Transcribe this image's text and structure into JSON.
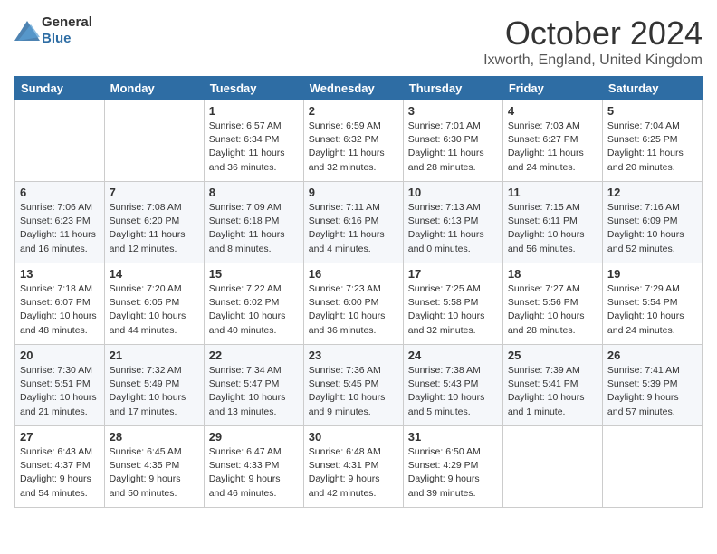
{
  "header": {
    "logo_general": "General",
    "logo_blue": "Blue",
    "month": "October 2024",
    "location": "Ixworth, England, United Kingdom"
  },
  "days_of_week": [
    "Sunday",
    "Monday",
    "Tuesday",
    "Wednesday",
    "Thursday",
    "Friday",
    "Saturday"
  ],
  "weeks": [
    [
      {
        "day": "",
        "info": ""
      },
      {
        "day": "",
        "info": ""
      },
      {
        "day": "1",
        "info": "Sunrise: 6:57 AM\nSunset: 6:34 PM\nDaylight: 11 hours\nand 36 minutes."
      },
      {
        "day": "2",
        "info": "Sunrise: 6:59 AM\nSunset: 6:32 PM\nDaylight: 11 hours\nand 32 minutes."
      },
      {
        "day": "3",
        "info": "Sunrise: 7:01 AM\nSunset: 6:30 PM\nDaylight: 11 hours\nand 28 minutes."
      },
      {
        "day": "4",
        "info": "Sunrise: 7:03 AM\nSunset: 6:27 PM\nDaylight: 11 hours\nand 24 minutes."
      },
      {
        "day": "5",
        "info": "Sunrise: 7:04 AM\nSunset: 6:25 PM\nDaylight: 11 hours\nand 20 minutes."
      }
    ],
    [
      {
        "day": "6",
        "info": "Sunrise: 7:06 AM\nSunset: 6:23 PM\nDaylight: 11 hours\nand 16 minutes."
      },
      {
        "day": "7",
        "info": "Sunrise: 7:08 AM\nSunset: 6:20 PM\nDaylight: 11 hours\nand 12 minutes."
      },
      {
        "day": "8",
        "info": "Sunrise: 7:09 AM\nSunset: 6:18 PM\nDaylight: 11 hours\nand 8 minutes."
      },
      {
        "day": "9",
        "info": "Sunrise: 7:11 AM\nSunset: 6:16 PM\nDaylight: 11 hours\nand 4 minutes."
      },
      {
        "day": "10",
        "info": "Sunrise: 7:13 AM\nSunset: 6:13 PM\nDaylight: 11 hours\nand 0 minutes."
      },
      {
        "day": "11",
        "info": "Sunrise: 7:15 AM\nSunset: 6:11 PM\nDaylight: 10 hours\nand 56 minutes."
      },
      {
        "day": "12",
        "info": "Sunrise: 7:16 AM\nSunset: 6:09 PM\nDaylight: 10 hours\nand 52 minutes."
      }
    ],
    [
      {
        "day": "13",
        "info": "Sunrise: 7:18 AM\nSunset: 6:07 PM\nDaylight: 10 hours\nand 48 minutes."
      },
      {
        "day": "14",
        "info": "Sunrise: 7:20 AM\nSunset: 6:05 PM\nDaylight: 10 hours\nand 44 minutes."
      },
      {
        "day": "15",
        "info": "Sunrise: 7:22 AM\nSunset: 6:02 PM\nDaylight: 10 hours\nand 40 minutes."
      },
      {
        "day": "16",
        "info": "Sunrise: 7:23 AM\nSunset: 6:00 PM\nDaylight: 10 hours\nand 36 minutes."
      },
      {
        "day": "17",
        "info": "Sunrise: 7:25 AM\nSunset: 5:58 PM\nDaylight: 10 hours\nand 32 minutes."
      },
      {
        "day": "18",
        "info": "Sunrise: 7:27 AM\nSunset: 5:56 PM\nDaylight: 10 hours\nand 28 minutes."
      },
      {
        "day": "19",
        "info": "Sunrise: 7:29 AM\nSunset: 5:54 PM\nDaylight: 10 hours\nand 24 minutes."
      }
    ],
    [
      {
        "day": "20",
        "info": "Sunrise: 7:30 AM\nSunset: 5:51 PM\nDaylight: 10 hours\nand 21 minutes."
      },
      {
        "day": "21",
        "info": "Sunrise: 7:32 AM\nSunset: 5:49 PM\nDaylight: 10 hours\nand 17 minutes."
      },
      {
        "day": "22",
        "info": "Sunrise: 7:34 AM\nSunset: 5:47 PM\nDaylight: 10 hours\nand 13 minutes."
      },
      {
        "day": "23",
        "info": "Sunrise: 7:36 AM\nSunset: 5:45 PM\nDaylight: 10 hours\nand 9 minutes."
      },
      {
        "day": "24",
        "info": "Sunrise: 7:38 AM\nSunset: 5:43 PM\nDaylight: 10 hours\nand 5 minutes."
      },
      {
        "day": "25",
        "info": "Sunrise: 7:39 AM\nSunset: 5:41 PM\nDaylight: 10 hours\nand 1 minute."
      },
      {
        "day": "26",
        "info": "Sunrise: 7:41 AM\nSunset: 5:39 PM\nDaylight: 9 hours\nand 57 minutes."
      }
    ],
    [
      {
        "day": "27",
        "info": "Sunrise: 6:43 AM\nSunset: 4:37 PM\nDaylight: 9 hours\nand 54 minutes."
      },
      {
        "day": "28",
        "info": "Sunrise: 6:45 AM\nSunset: 4:35 PM\nDaylight: 9 hours\nand 50 minutes."
      },
      {
        "day": "29",
        "info": "Sunrise: 6:47 AM\nSunset: 4:33 PM\nDaylight: 9 hours\nand 46 minutes."
      },
      {
        "day": "30",
        "info": "Sunrise: 6:48 AM\nSunset: 4:31 PM\nDaylight: 9 hours\nand 42 minutes."
      },
      {
        "day": "31",
        "info": "Sunrise: 6:50 AM\nSunset: 4:29 PM\nDaylight: 9 hours\nand 39 minutes."
      },
      {
        "day": "",
        "info": ""
      },
      {
        "day": "",
        "info": ""
      }
    ]
  ]
}
